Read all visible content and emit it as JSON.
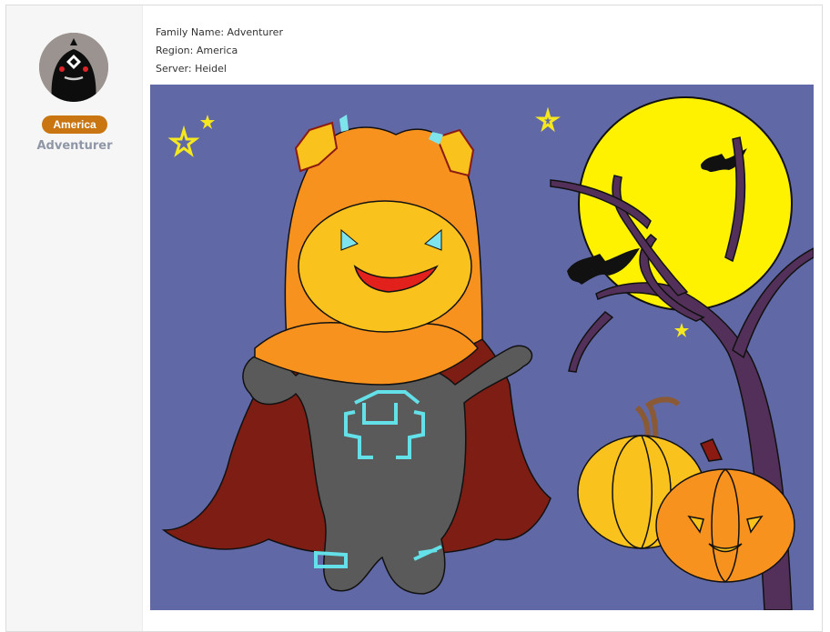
{
  "profile": {
    "region_badge": "America",
    "display_name": "Adventurer",
    "badge_color": "#c87512",
    "avatar_icon": "black-spirit-avatar-icon"
  },
  "info": {
    "family_name": "Family Name: Adventurer",
    "region": "Region: America",
    "server": "Server: Heidel"
  },
  "artwork": {
    "background_color": "#6168a6",
    "moon_color": "#fff200"
  }
}
